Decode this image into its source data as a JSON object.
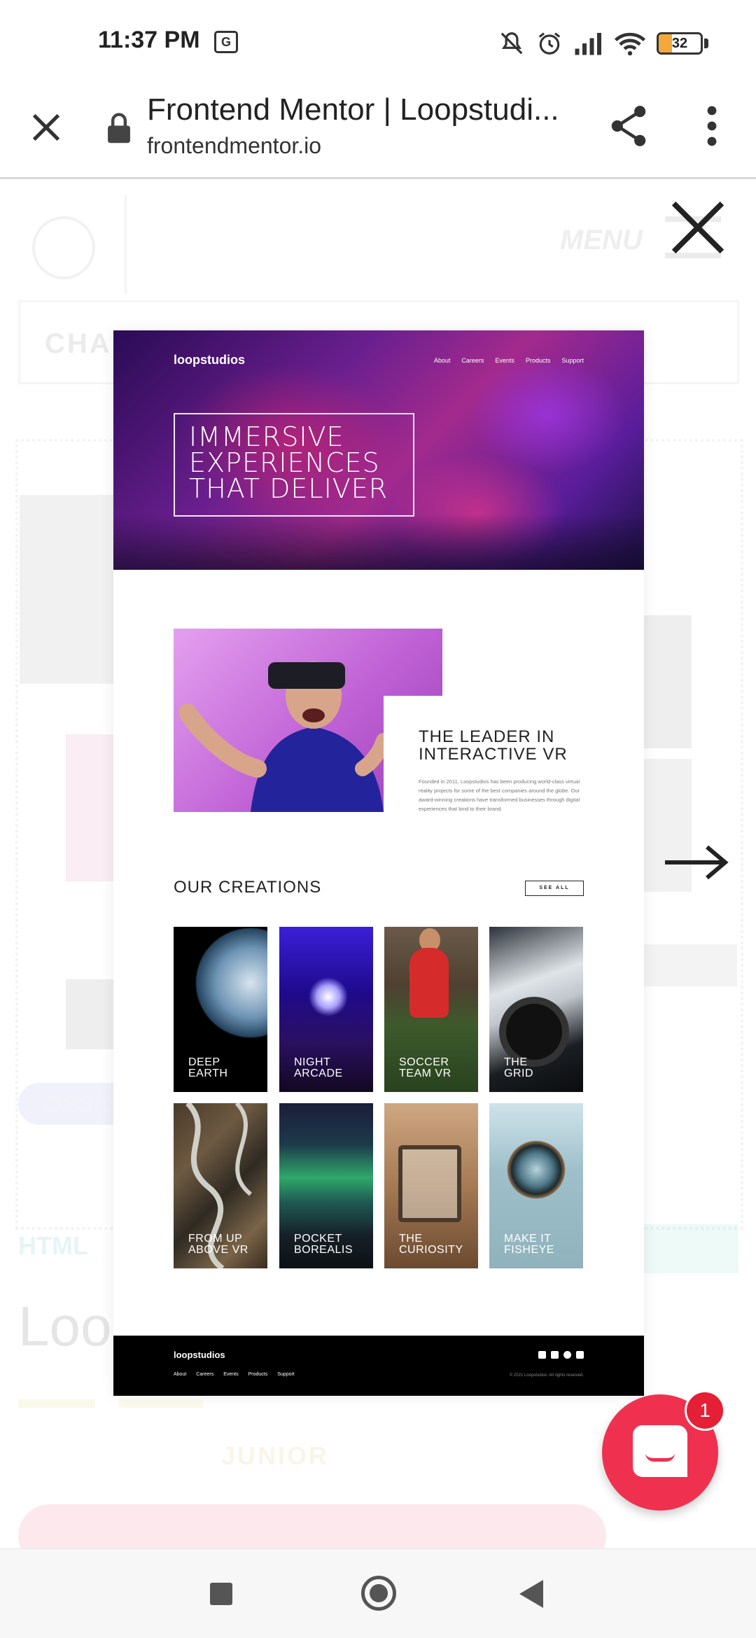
{
  "status_bar": {
    "time": "11:37 PM",
    "translate_glyph": "G",
    "battery_percent": "32",
    "icons": [
      "mute-icon",
      "alarm-icon",
      "signal-icon",
      "wifi-icon",
      "battery-icon"
    ]
  },
  "browser": {
    "title": "Frontend Mentor | Loopstudi...",
    "url": "frontendmentor.io"
  },
  "preview": {
    "logo": "loopstudios",
    "nav": [
      "About",
      "Careers",
      "Events",
      "Products",
      "Support"
    ],
    "hero_lines": [
      "IMMERSIVE",
      "EXPERIENCES",
      "THAT DELIVER"
    ],
    "leader_title_lines": [
      "THE LEADER IN",
      "INTERACTIVE VR"
    ],
    "leader_text": "Founded in 2011, Loopstudios has been producing world-class virtual reality projects for some of the best companies around the globe. Our award-winning creations have transformed businesses through digital experiences that bind to their brand.",
    "creations_title": "OUR CREATIONS",
    "see_all": "SEE ALL",
    "creations": [
      {
        "line1": "DEEP",
        "line2": "EARTH"
      },
      {
        "line1": "NIGHT",
        "line2": "ARCADE"
      },
      {
        "line1": "SOCCER",
        "line2": "TEAM VR"
      },
      {
        "line1": "THE",
        "line2": "GRID"
      },
      {
        "line1": "FROM UP",
        "line2": "ABOVE VR"
      },
      {
        "line1": "POCKET",
        "line2": "BOREALIS"
      },
      {
        "line1": "THE",
        "line2": "CURIOSITY"
      },
      {
        "line1": "MAKE IT",
        "line2": "FISHEYE"
      }
    ],
    "footer": {
      "logo": "loopstudios",
      "nav": [
        "About",
        "Careers",
        "Events",
        "Products",
        "Support"
      ],
      "copyright": "© 2021 Loopstudios. All rights reserved."
    }
  },
  "chat": {
    "badge_count": "1"
  }
}
